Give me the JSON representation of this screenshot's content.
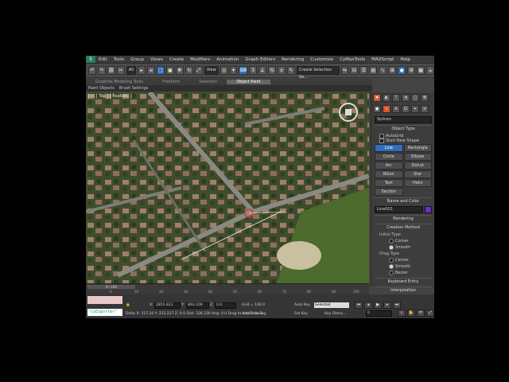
{
  "menu": {
    "logo": "S",
    "items": [
      "Edit",
      "Tools",
      "Group",
      "Views",
      "Create",
      "Modifiers",
      "Animation",
      "Graph Editors",
      "Rendering",
      "Customize",
      "CyMaxTools",
      "MAXScript",
      "Help"
    ]
  },
  "toolbar": {
    "selection_filter": "All",
    "view_dropdown": "View",
    "named_selection": "Create Selection Se..."
  },
  "ribbon": {
    "tabs": [
      "Graphite Modeling Tools",
      "Freeform",
      "Selection",
      "Object Paint"
    ],
    "active_tab": "Object Paint",
    "sub_items": [
      "Paint Objects",
      "Brush Settings"
    ]
  },
  "viewport": {
    "label": "[+] [ Top ] [ Realistic ]"
  },
  "command_panel": {
    "category": "Splines",
    "object_type_title": "Object Type",
    "autogrid_label": "AutoGrid",
    "start_new_shape_label": "Start New Shape",
    "buttons": [
      "Line",
      "Rectangle",
      "Circle",
      "Ellipse",
      "Arc",
      "Donut",
      "NGon",
      "Star",
      "Text",
      "Helix",
      "Section"
    ],
    "active_button": "Line",
    "name_color_title": "Name and Color",
    "name_value": "Line001",
    "name_color": "#6a2fd0",
    "rendering_title": "Rendering",
    "creation_method_title": "Creation Method",
    "initial_type_label": "Initial Type",
    "initial_type_options": [
      "Corner",
      "Smooth"
    ],
    "initial_type_selected": "Smooth",
    "drag_type_label": "Drag Type",
    "drag_type_options": [
      "Corner",
      "Smooth",
      "Bezier"
    ],
    "drag_type_selected": "Smooth",
    "keyboard_entry_title": "Keyboard Entry",
    "interpolation_title": "Interpolation"
  },
  "timeline": {
    "slider_label": "0 / 100",
    "ticks": [
      "0",
      "10",
      "20",
      "30",
      "40",
      "50",
      "60",
      "70",
      "80",
      "90",
      "100"
    ]
  },
  "status": {
    "script_listener": "\"cyExporter\"",
    "x_label": "X:",
    "x_value": "2855.921",
    "y_label": "Y:",
    "y_value": "893.109",
    "z_label": "Z:",
    "z_value": "0.0",
    "grid_label": "Grid = 100.0",
    "delta_text": "Delta X: 317.20  Y: 222.227  Z: 0.0  Dist: 338.330  Ang: 0.0  Drag to create lines",
    "add_time_tag": "Add Time Tag",
    "auto_key": "Auto Key",
    "auto_key_value": "Selected",
    "set_key": "Set Key",
    "key_filters": "Key Filters...",
    "frame_value": "0"
  }
}
